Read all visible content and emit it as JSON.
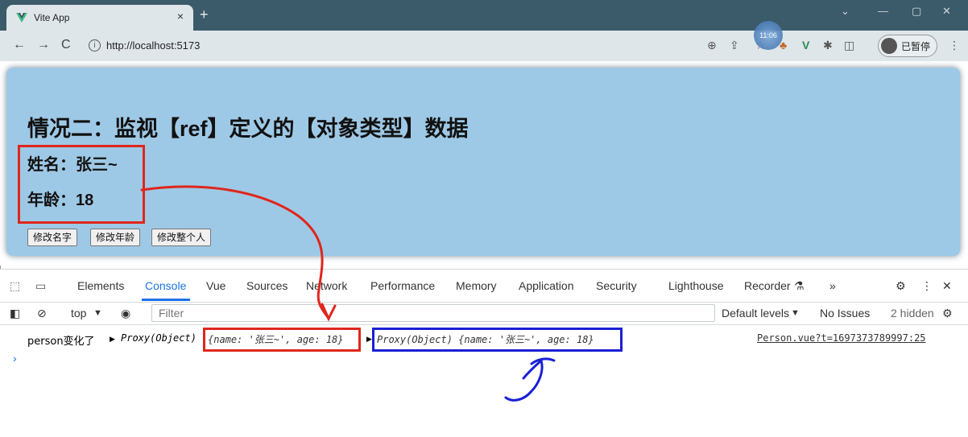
{
  "browser": {
    "tab_title": "Vite App",
    "tab_close": "×",
    "new_tab": "+",
    "back": "←",
    "forward": "→",
    "reload": "C",
    "url": "http://localhost:5173",
    "profile_label": "已暂停",
    "clock": "11:06"
  },
  "page": {
    "heading": "情况二：监视【ref】定义的【对象类型】数据",
    "name_line": "姓名：张三~",
    "age_line": "年龄：18",
    "buttons": [
      "修改名字",
      "修改年龄",
      "修改整个人"
    ]
  },
  "devtools": {
    "tabs": [
      "Elements",
      "Console",
      "Vue",
      "Sources",
      "Network",
      "Performance",
      "Memory",
      "Application",
      "Security",
      "Lighthouse",
      "Recorder",
      "»"
    ],
    "active_tab": "Console",
    "context": "top",
    "filter_placeholder": "Filter",
    "levels": "Default levels",
    "issues": "No Issues",
    "hidden": "2 hidden",
    "log": {
      "label": "person变化了",
      "proxy1": "Proxy(Object)",
      "obj1": "{name: '张三~', age: 18}",
      "proxy2": "Proxy(Object) {name: '张三~', age: 18}",
      "source": "Person.vue?t=1697373789997:25"
    },
    "prompt": "›"
  },
  "colors": {
    "card": "#9ec9e6",
    "annotation_red": "#e0261c",
    "annotation_blue": "#1a1fd6",
    "accent": "#1a73e8"
  }
}
